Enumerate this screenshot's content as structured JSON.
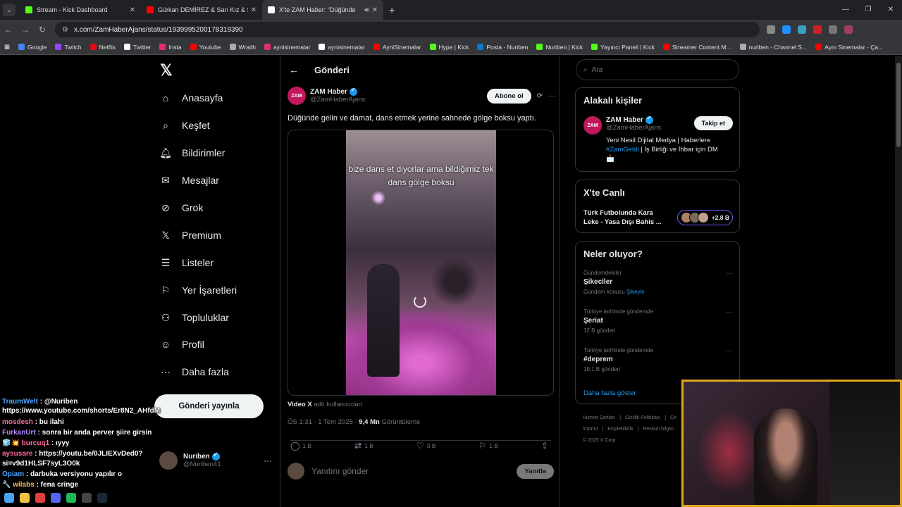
{
  "browser": {
    "tabs": [
      {
        "title": "Stream - Kick Dashboard",
        "color": "#53fc18"
      },
      {
        "title": "Gürkan DEMİREZ & Sarı Kız & Şeyh",
        "color": "#ff0000"
      },
      {
        "title": "X'te ZAM Haber: \"Düğünde",
        "color": "#ffffff"
      }
    ],
    "url": "x.com/ZamHaberAjans/status/1939995200178319390",
    "bookmarks": [
      {
        "label": "Google",
        "color": "#4285f4"
      },
      {
        "label": "Twitch",
        "color": "#9146ff"
      },
      {
        "label": "Netflix",
        "color": "#e50914"
      },
      {
        "label": "Twitter",
        "color": "#ffffff"
      },
      {
        "label": "Insta",
        "color": "#e1306c"
      },
      {
        "label": "Youtube",
        "color": "#ff0000"
      },
      {
        "label": "Wraith",
        "color": "#aaaaaa"
      },
      {
        "label": "aynisinemalar",
        "color": "#e1306c"
      },
      {
        "label": "aynisinemalar",
        "color": "#ffffff"
      },
      {
        "label": "AyniSinemalar",
        "color": "#ff0000"
      },
      {
        "label": "Hype | Kick",
        "color": "#53fc18"
      },
      {
        "label": "Posta - Nuriben",
        "color": "#0078d4"
      },
      {
        "label": "Nuriben | Kick",
        "color": "#53fc18"
      },
      {
        "label": "Yayıncı Paneli | Kick",
        "color": "#53fc18"
      },
      {
        "label": "Streamer Content M...",
        "color": "#ff0000"
      },
      {
        "label": "nuriben - Channel S...",
        "color": "#aaaaaa"
      },
      {
        "label": "Aynı Sinemalar - Ça...",
        "color": "#ff0000"
      }
    ]
  },
  "nav": {
    "items": [
      {
        "label": "Anasayfa",
        "icon": "home-icon",
        "glyph": "⌂"
      },
      {
        "label": "Keşfet",
        "icon": "search-icon",
        "glyph": "⌕"
      },
      {
        "label": "Bildirimler",
        "icon": "bell-icon",
        "glyph": "🔔︎"
      },
      {
        "label": "Mesajlar",
        "icon": "mail-icon",
        "glyph": "✉"
      },
      {
        "label": "Grok",
        "icon": "grok-icon",
        "glyph": "⊘"
      },
      {
        "label": "Premium",
        "icon": "x-icon",
        "glyph": "𝕏"
      },
      {
        "label": "Listeler",
        "icon": "list-icon",
        "glyph": "☰"
      },
      {
        "label": "Yer İşaretleri",
        "icon": "bookmark-icon",
        "glyph": "⚐"
      },
      {
        "label": "Topluluklar",
        "icon": "people-icon",
        "glyph": "⚇"
      },
      {
        "label": "Profil",
        "icon": "profile-icon",
        "glyph": "☺"
      },
      {
        "label": "Daha fazla",
        "icon": "more-circle-icon",
        "glyph": "⋯"
      }
    ],
    "post_button": "Gönderi yayınla",
    "account": {
      "name": "Nuriben",
      "handle": "@Nuriben41"
    }
  },
  "post": {
    "header": "Gönderi",
    "author_name": "ZAM Haber",
    "author_handle": "@ZamHaberAjans",
    "avatar_text": "ZAM",
    "subscribe": "Abone ol",
    "text": "Düğünde gelin ve damat, dans etmek yerine sahnede gölge boksu yaptı.",
    "video_caption": "bize dans et diyorlar ama bildiğimiz tek dans gölge boksu",
    "attribution_name": "Video X",
    "attribution_rest": "adlı kullanıcıdan",
    "time": "ÖS 1:31 · 1 Tem 2025 ·",
    "views": "9,4 Mn",
    "views_label": "Görüntüleme",
    "actions": [
      {
        "icon": "reply-icon",
        "glyph": "◯",
        "count": "1 B"
      },
      {
        "icon": "repost-icon",
        "glyph": "⇄",
        "count": "1 B"
      },
      {
        "icon": "like-icon",
        "glyph": "♡",
        "count": "3 B"
      },
      {
        "icon": "bookmark-icon",
        "glyph": "⚐",
        "count": "1 B"
      },
      {
        "icon": "share-icon",
        "glyph": "⇪",
        "count": ""
      }
    ],
    "reply_placeholder": "Yanıtını gönder",
    "reply_button": "Yanıtla"
  },
  "right": {
    "search_placeholder": "Ara",
    "related": {
      "title": "Alakalı kişiler",
      "name": "ZAM Haber",
      "handle": "@ZamHaberAjans",
      "follow": "Takip et",
      "bio_1": "Yeni Nesil Dijital Medya | Haberlere",
      "bio_tag": "#ZamGeldi",
      "bio_2": "| İş Birliği ve İhbar için DM",
      "bio_3": "📩"
    },
    "live": {
      "title": "X'te Canlı",
      "text": "Türk Futbolunda Kara Leke - Yasa Dışı Bahis ...",
      "count": "+2,8 B"
    },
    "trends": {
      "title": "Neler oluyor?",
      "items": [
        {
          "context": "Gündemdekiler",
          "topic": "Şikeciler",
          "sub": "Gündem konusu",
          "sub_link": "Şikeyle"
        },
        {
          "context": "Türkiye tarihinde gündemde",
          "topic": "Şeriat",
          "sub": "12 B gönderi",
          "sub_link": ""
        },
        {
          "context": "Türkiye tarihinde gündemde",
          "topic": "#deprem",
          "sub": "19,1 B gönderi",
          "sub_link": ""
        }
      ],
      "show_more": "Daha fazla göster"
    },
    "footer": [
      "Hizmet Şartları",
      "|",
      "Gizlilik Politikası",
      "|",
      "Çe",
      "Imprint",
      "|",
      "Erişilebilirlik",
      "|",
      "Reklam bilgisi",
      "© 2025 X Corp."
    ]
  },
  "chat": [
    {
      "user": "TraumWelt",
      "color": "#4da6ff",
      "text": ": @Nuriben https://www.youtube.com/shorts/Er8N2_AHfdM"
    },
    {
      "user": "mosdesh",
      "color": "#ff6b9d",
      "text": ": bu ilahi"
    },
    {
      "user": "FurkanUrt",
      "color": "#b388ff",
      "text": ": sonra bir anda perver şiire girsin"
    },
    {
      "user": "🧊💥 burcuq1",
      "color": "#ff6b9d",
      "text": ": ıyyy"
    },
    {
      "user": "aysusare",
      "color": "#ff6b9d",
      "text": ": https://youtu.be/0JLIEXvDed0?si=v9d1HLSF7syL3O0k"
    },
    {
      "user": "Opiam",
      "color": "#4da6ff",
      "text": ": darbuka versiyonu yapılır o"
    },
    {
      "user": "🔧 wilabs",
      "color": "#ffb74d",
      "text": ": fena cringe"
    }
  ]
}
